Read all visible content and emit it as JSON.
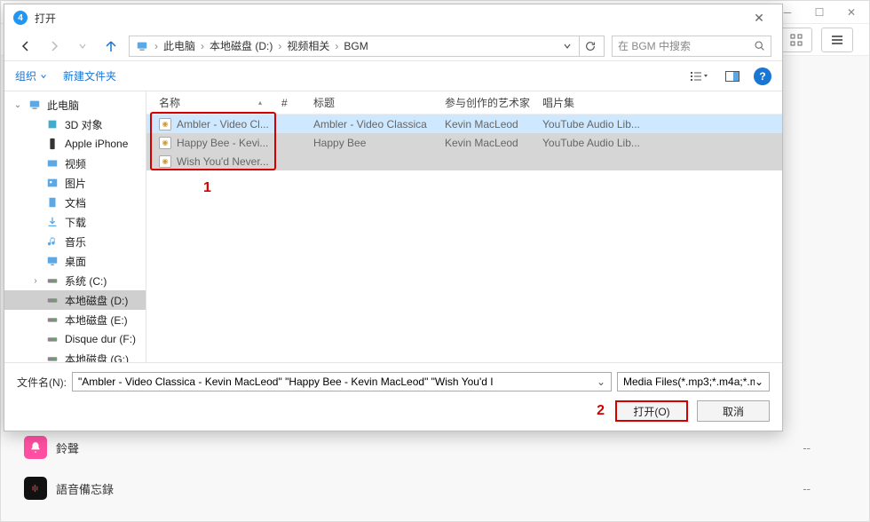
{
  "bg": {
    "row1": {
      "label": "鈴聲",
      "value": "--"
    },
    "row2": {
      "label": "語音備忘錄",
      "value": "--"
    }
  },
  "dialog": {
    "title": "打开",
    "breadcrumb": [
      "此电脑",
      "本地磁盘 (D:)",
      "视频相关",
      "BGM"
    ],
    "search_placeholder": "在 BGM 中搜索",
    "toolbar": {
      "organize": "组织",
      "new_folder": "新建文件夹"
    },
    "tree": {
      "root": "此电脑",
      "children": [
        {
          "label": "3D 对象",
          "icon": "3d"
        },
        {
          "label": "Apple iPhone",
          "icon": "phone"
        },
        {
          "label": "视频",
          "icon": "video"
        },
        {
          "label": "图片",
          "icon": "pic"
        },
        {
          "label": "文档",
          "icon": "doc"
        },
        {
          "label": "下载",
          "icon": "download"
        },
        {
          "label": "音乐",
          "icon": "music"
        },
        {
          "label": "桌面",
          "icon": "desktop"
        },
        {
          "label": "系统 (C:)",
          "icon": "drive",
          "expandable": true
        },
        {
          "label": "本地磁盘 (D:)",
          "icon": "drive",
          "selected": true
        },
        {
          "label": "本地磁盘 (E:)",
          "icon": "drive"
        },
        {
          "label": "Disque dur (F:)",
          "icon": "drive"
        },
        {
          "label": "本地磁盘 (G:)",
          "icon": "drive"
        }
      ]
    },
    "columns": {
      "name": "名称",
      "num": "#",
      "title": "标题",
      "artist": "参与创作的艺术家",
      "album": "唱片集"
    },
    "rows": [
      {
        "name": "Ambler - Video Cl...",
        "title": "Ambler - Video Classica",
        "artist": "Kevin MacLeod",
        "album": "YouTube Audio Lib..."
      },
      {
        "name": "Happy Bee - Kevi...",
        "title": "Happy Bee",
        "artist": "Kevin MacLeod",
        "album": "YouTube Audio Lib..."
      },
      {
        "name": "Wish You'd Never...",
        "title": "",
        "artist": "",
        "album": ""
      }
    ],
    "footer": {
      "fname_label": "文件名(N):",
      "fname_value": "\"Ambler - Video Classica - Kevin MacLeod\" \"Happy Bee - Kevin MacLeod\" \"Wish You'd I",
      "filter": "Media Files(*.mp3;*.m4a;*.m",
      "open": "打开(O)",
      "cancel": "取消"
    }
  },
  "annotations": {
    "one": "1",
    "two": "2"
  }
}
